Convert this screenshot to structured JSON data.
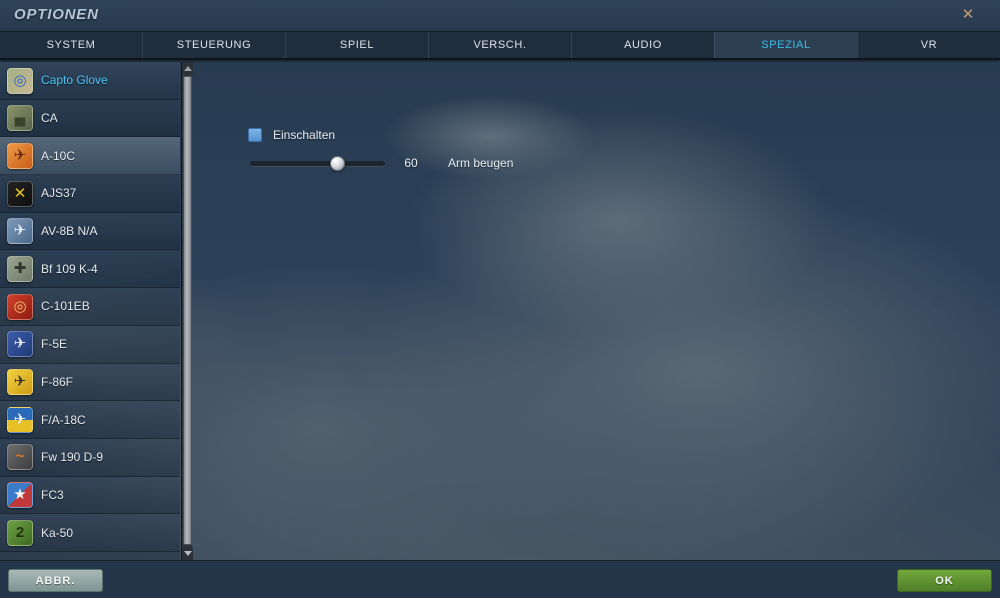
{
  "window": {
    "title": "OPTIONEN",
    "close_glyph": "✕"
  },
  "tabs": [
    {
      "label": "SYSTEM",
      "active": false
    },
    {
      "label": "STEUERUNG",
      "active": false
    },
    {
      "label": "SPIEL",
      "active": false
    },
    {
      "label": "VERSCH.",
      "active": false
    },
    {
      "label": "AUDIO",
      "active": false
    },
    {
      "label": "SPEZIAL",
      "active": true
    },
    {
      "label": "VR",
      "active": false
    }
  ],
  "sidebar": {
    "items": [
      {
        "label": "Capto Glove",
        "icon": "capto-glove-module",
        "selected": true,
        "highlighted": false,
        "icon_colors": [
          "#a3b184",
          "#c6b694"
        ],
        "glyph": "◎",
        "glyph_color": "#2a5ec4"
      },
      {
        "label": "CA",
        "icon": "combined-arms-module",
        "selected": false,
        "highlighted": false,
        "icon_colors": [
          "#8a9468",
          "#55624a"
        ],
        "glyph": "▄",
        "glyph_color": "#39442e"
      },
      {
        "label": "A-10C",
        "icon": "a10c-module",
        "selected": false,
        "highlighted": true,
        "icon_colors": [
          "#f09a48",
          "#c85d18"
        ],
        "glyph": "✈",
        "glyph_color": "#5d2e10"
      },
      {
        "label": "AJS37",
        "icon": "ajs37-module",
        "selected": false,
        "highlighted": false,
        "icon_colors": [
          "#232323",
          "#0e0e0e"
        ],
        "glyph": "✕",
        "glyph_color": "#e6c31e"
      },
      {
        "label": "AV-8B N/A",
        "icon": "av8b-module",
        "selected": false,
        "highlighted": false,
        "icon_colors": [
          "#7e9ab9",
          "#49678a"
        ],
        "glyph": "✈",
        "glyph_color": "#e3ebf4"
      },
      {
        "label": "Bf 109 K-4",
        "icon": "bf109-module",
        "selected": false,
        "highlighted": false,
        "icon_colors": [
          "#9aa592",
          "#6d7966"
        ],
        "glyph": "✚",
        "glyph_color": "#31352d"
      },
      {
        "label": "C-101EB",
        "icon": "c101eb-module",
        "selected": false,
        "highlighted": false,
        "icon_colors": [
          "#d2412e",
          "#8c1a10"
        ],
        "glyph": "◎",
        "glyph_color": "#ecc66a"
      },
      {
        "label": "F-5E",
        "icon": "f5e-module",
        "selected": false,
        "highlighted": false,
        "icon_colors": [
          "#3c5cab",
          "#1f3a77"
        ],
        "glyph": "✈",
        "glyph_color": "#e8e8ea"
      },
      {
        "label": "F-86F",
        "icon": "f86f-module",
        "selected": false,
        "highlighted": false,
        "icon_colors": [
          "#f0d23f",
          "#cf9b16"
        ],
        "glyph": "✈",
        "glyph_color": "#34302a"
      },
      {
        "label": "F/A-18C",
        "icon": "fa18c-module",
        "selected": false,
        "highlighted": false,
        "icon_colors": [
          "#2a6ab8",
          "#e7c028"
        ],
        "glyph": "✈",
        "glyph_color": "#f2f2f2",
        "icon_split": true,
        "icon_angle": "180deg"
      },
      {
        "label": "Fw 190 D-9",
        "icon": "fw190d9-module",
        "selected": false,
        "highlighted": false,
        "icon_colors": [
          "#6e6e6e",
          "#3c3c3c"
        ],
        "glyph": "~",
        "glyph_color": "#e07a20"
      },
      {
        "label": "FC3",
        "icon": "fc3-module",
        "selected": false,
        "highlighted": false,
        "icon_colors": [
          "#3a7ac9",
          "#c23838"
        ],
        "glyph": "★",
        "glyph_color": "#f2f2f2",
        "icon_split": true,
        "icon_angle": "135deg"
      },
      {
        "label": "Ka-50",
        "icon": "ka50-module",
        "selected": false,
        "highlighted": false,
        "icon_colors": [
          "#6fa043",
          "#3e6a23"
        ],
        "glyph": "2",
        "glyph_color": "#20350f"
      }
    ]
  },
  "content": {
    "checkbox_label": "Einschalten",
    "checkbox_checked": true,
    "slider": {
      "value": "60",
      "label": "Arm beugen",
      "percent": 65
    }
  },
  "footer": {
    "cancel_label": "ABBR.",
    "ok_label": "OK"
  },
  "colors": {
    "accent_cyan": "#41b6e8",
    "selected_item_cyan": "#4cc5f5",
    "checkbox_blue": "#6aa6dd",
    "ok_green": "#5e8f33",
    "cancel_grey": "#93a7a4",
    "close_orange": "#c49a76"
  }
}
